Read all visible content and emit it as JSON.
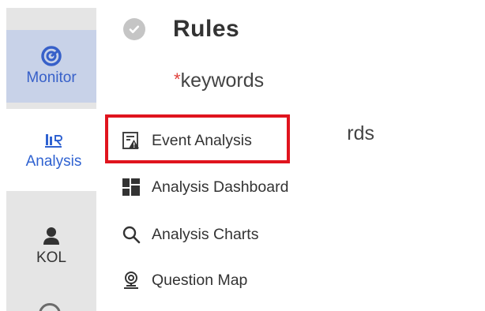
{
  "rail": {
    "items": [
      {
        "label": "Monitor",
        "icon": "monitor-gauge-icon",
        "active": false
      },
      {
        "label": "Analysis",
        "icon": "analysis-bar-icon",
        "active": true
      },
      {
        "label": "KOL",
        "icon": "person-icon",
        "active": false
      }
    ]
  },
  "header": {
    "title": "Rules",
    "status_icon": "check-circle-icon"
  },
  "form": {
    "required_mark": "*",
    "keywords_label": "keywords",
    "partial_label": "rds"
  },
  "menu": {
    "items": [
      {
        "label": "Event Analysis",
        "icon": "event-warning-icon"
      },
      {
        "label": "Analysis Dashboard",
        "icon": "dashboard-grid-icon"
      },
      {
        "label": "Analysis Charts",
        "icon": "search-icon"
      },
      {
        "label": "Question Map",
        "icon": "map-pin-icon"
      }
    ],
    "highlighted": "Event Analysis"
  },
  "colors": {
    "accent": "#2f62d1",
    "highlight": "#e0141e",
    "required": "#e0403a",
    "rail_bg": "#e5e5e5",
    "rail_active_bg": "#c8d2e8"
  }
}
